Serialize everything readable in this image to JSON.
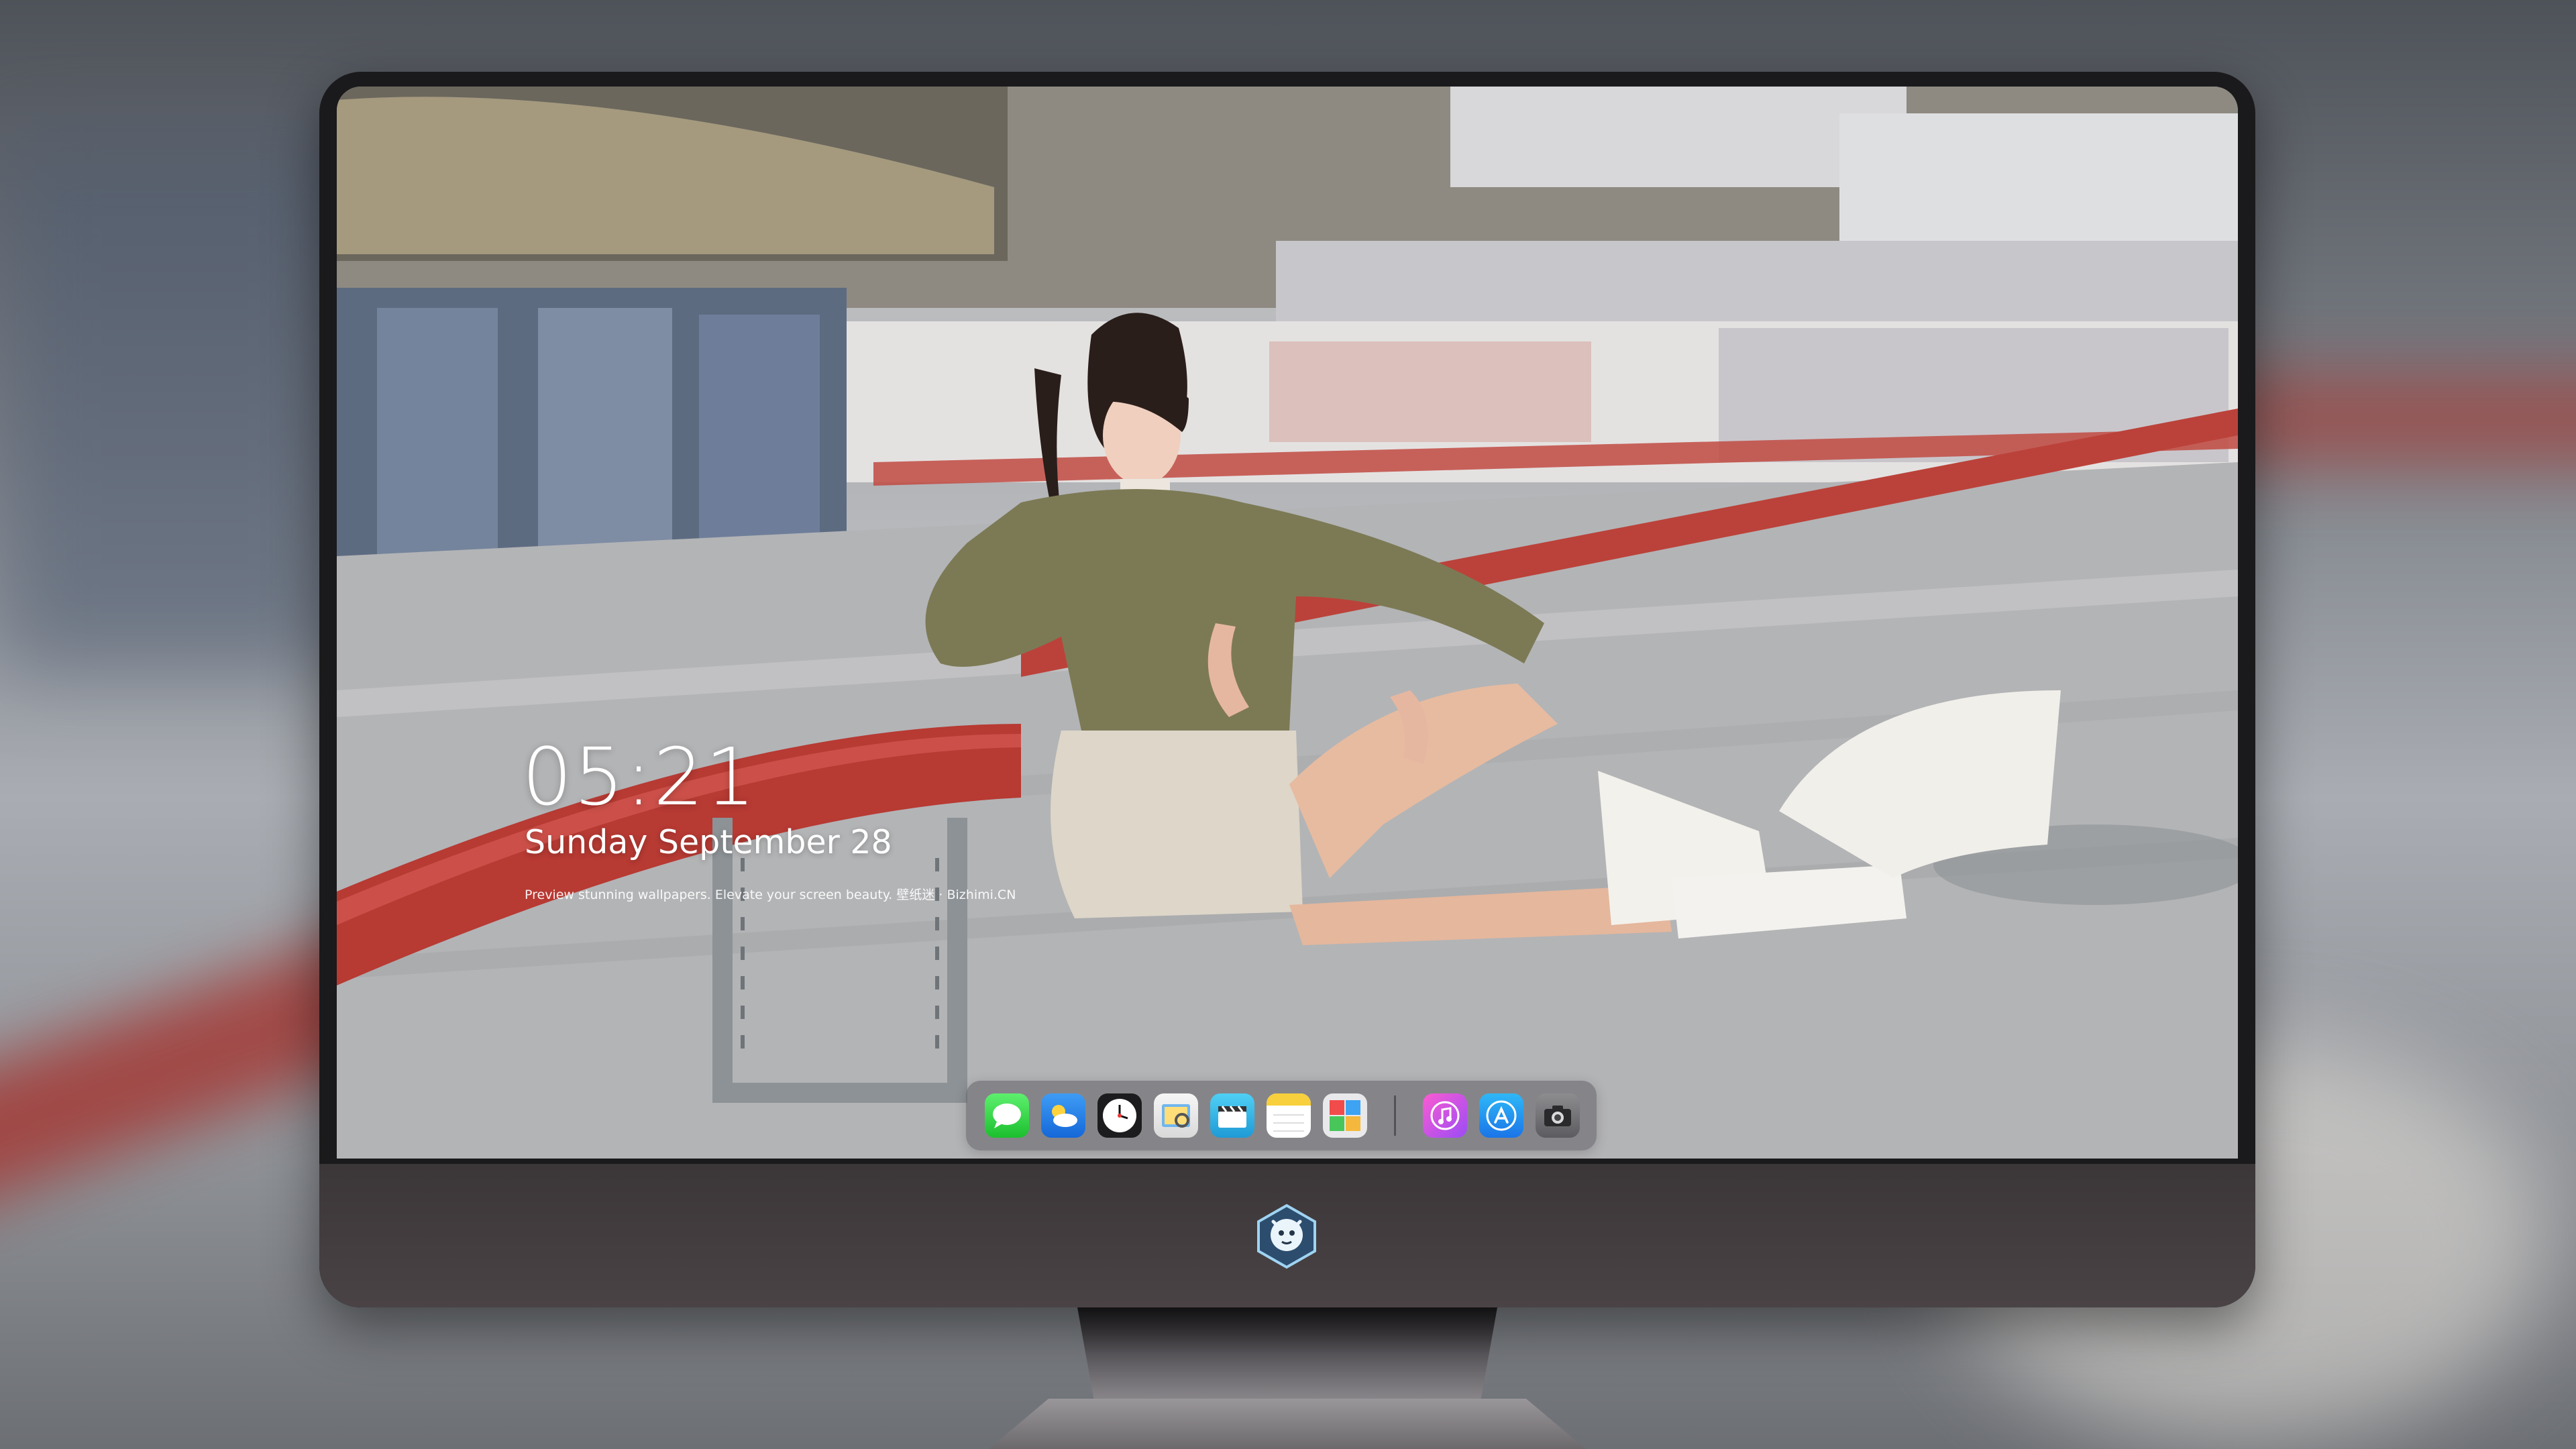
{
  "lock_screen": {
    "time": "05:21",
    "date": "Sunday September  28",
    "tagline": "Preview stunning wallpapers. Elevate your screen beauty. 壁纸迷 · Bizhimi.CN"
  },
  "dock": {
    "apps": [
      {
        "name": "Messages",
        "icon": "messages-icon"
      },
      {
        "name": "Weather",
        "icon": "weather-icon"
      },
      {
        "name": "Clock",
        "icon": "clock-icon"
      },
      {
        "name": "Preview",
        "icon": "preview-icon"
      },
      {
        "name": "Clips",
        "icon": "clapperboard-icon"
      },
      {
        "name": "Notes",
        "icon": "notes-icon"
      },
      {
        "name": "Photo Booth",
        "icon": "photo-booth-icon"
      }
    ],
    "pinned": [
      {
        "name": "iTunes",
        "icon": "music-icon"
      },
      {
        "name": "App Store",
        "icon": "app-store-icon"
      },
      {
        "name": "Camera",
        "icon": "camera-icon"
      }
    ]
  },
  "colors": {
    "monitor_bezel": "#1a1a1c",
    "monitor_chin": "#433d3f",
    "rail_red": "#b73a33",
    "dock_background": "#5f5f64"
  }
}
